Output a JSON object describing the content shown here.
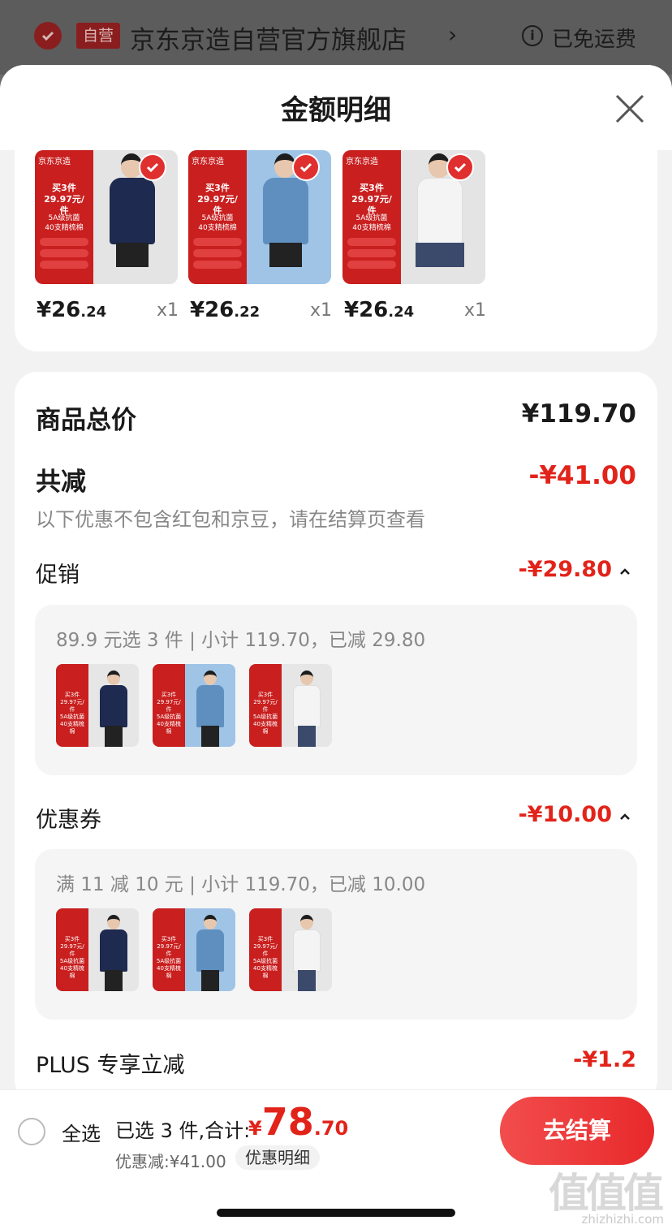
{
  "store_header": {
    "self_operated_badge": "自营",
    "store_name": "京东京造自营官方旗舰店",
    "info_icon": "i",
    "shipping": "已免运费"
  },
  "sheet": {
    "title": "金额明细"
  },
  "products": [
    {
      "price_int": "¥26",
      "price_dec": ".24",
      "qty": "x1",
      "thumb_logo": "京东京造",
      "thumb_buy": "买3件\n29.97元/件",
      "thumb_feat": "5A级抗菌\n40支精梳棉",
      "shirt_color": "#1e2a4f"
    },
    {
      "price_int": "¥26",
      "price_dec": ".22",
      "qty": "x1",
      "thumb_logo": "京东京造",
      "thumb_buy": "买3件\n29.97元/件",
      "thumb_feat": "5A级抗菌\n40支精梳棉",
      "shirt_color": "#5f8fbf"
    },
    {
      "price_int": "¥26",
      "price_dec": ".24",
      "qty": "x1",
      "thumb_logo": "京东京造",
      "thumb_buy": "买3件\n29.97元/件",
      "thumb_feat": "5A级抗菌\n40支精梳棉",
      "shirt_color": "#f4f4f4"
    }
  ],
  "summary": {
    "total_label": "商品总价",
    "total_value": "¥119.70",
    "reduce_label": "共减",
    "reduce_value": "-¥41.00",
    "note": "以下优惠不包含红包和京豆，请在结算页查看",
    "promo_label": "促销",
    "promo_value": "-¥29.80",
    "promo_detail": "89.9 元选 3 件 | 小计 119.70，已减 29.80",
    "coupon_label": "优惠券",
    "coupon_value": "-¥10.00",
    "coupon_detail": "满 11 减 10 元 | 小计 119.70，已减 10.00",
    "plus_label": "PLUS 专享立减",
    "plus_value": "-¥1.2"
  },
  "mini_thumb_text": "买3件\n29.97元/件\n5A级抗菌\n40支精梳棉",
  "bottom_bar": {
    "select_all": "全选",
    "selected_text": "已选 3 件,合计:",
    "total_symbol": "¥",
    "total_int": "78",
    "total_dec": ".70",
    "discount_text": "优惠减:¥41.00",
    "detail_pill": "优惠明细",
    "checkout": "去结算"
  },
  "watermark": {
    "logo": "值值值",
    "url": "zhizhizhi.com"
  },
  "colors": {
    "accent_red": "#e2231a",
    "checkout_gradient_start": "#f24d4d",
    "checkout_gradient_end": "#e8292b"
  }
}
